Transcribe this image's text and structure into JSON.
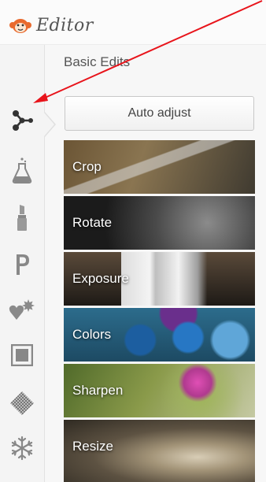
{
  "header": {
    "app_title": "Editor",
    "logo_icon": "monkey-face-icon"
  },
  "tool_rail": {
    "items": [
      {
        "name": "basic-edits",
        "icon": "branching-nodes-icon",
        "selected": true
      },
      {
        "name": "effects",
        "icon": "flask-icon"
      },
      {
        "name": "touch-up",
        "icon": "lipstick-icon"
      },
      {
        "name": "text",
        "icon": "letter-p-icon"
      },
      {
        "name": "stickers",
        "icon": "heart-burst-icon"
      },
      {
        "name": "frames",
        "icon": "framed-square-icon"
      },
      {
        "name": "textures",
        "icon": "textured-diamond-icon"
      },
      {
        "name": "overlays",
        "icon": "snowflake-icon"
      }
    ]
  },
  "panel": {
    "title": "Basic Edits",
    "auto_adjust_label": "Auto adjust",
    "edits": [
      {
        "label": "Crop"
      },
      {
        "label": "Rotate"
      },
      {
        "label": "Exposure"
      },
      {
        "label": "Colors"
      },
      {
        "label": "Sharpen"
      },
      {
        "label": "Resize"
      }
    ]
  },
  "colors": {
    "icon_gray": "#777777",
    "annotation_red": "#e8141b",
    "tile_text": "#ffffff"
  }
}
